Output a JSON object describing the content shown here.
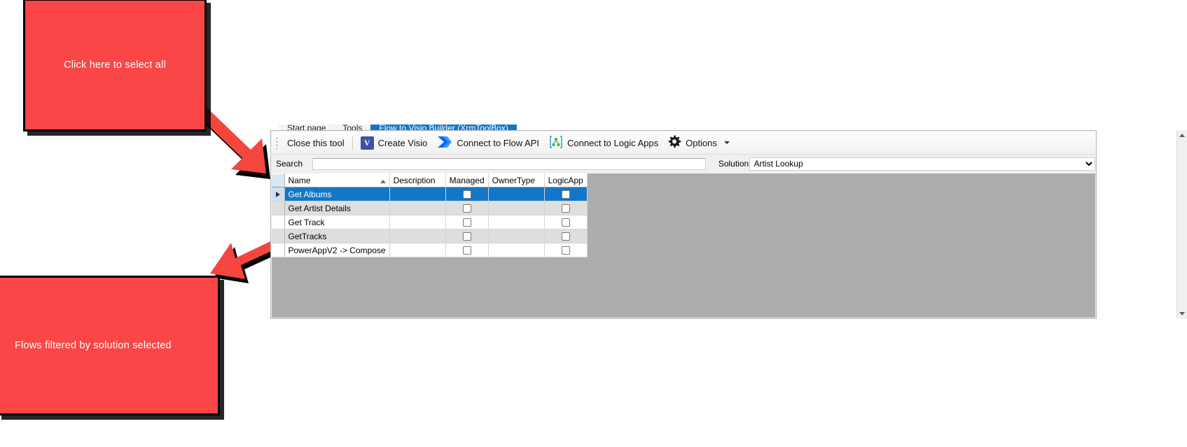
{
  "annotations": {
    "top_callout": "Click here to select all",
    "bottom_callout": "Flows filtered by solution selected",
    "color": "#fa4646"
  },
  "tabs": [
    {
      "label": "Start page",
      "active": false
    },
    {
      "label": "Tools",
      "active": false
    },
    {
      "label": "Flow to Visio Builder (XrmToolBox)",
      "active": true
    }
  ],
  "toolbar": {
    "close_tool": "Close this tool",
    "create_visio": "Create Visio",
    "connect_flow_api": "Connect to Flow API",
    "connect_logic_apps": "Connect to Logic Apps",
    "options": "Options",
    "icons": {
      "visio": "visio-icon",
      "flow": "power-automate-icon",
      "logic_apps": "logic-apps-icon",
      "options": "gear-icon",
      "dropdown": "chevron-down-icon"
    }
  },
  "search": {
    "label": "Search",
    "value": "",
    "placeholder": ""
  },
  "solution": {
    "label": "Solution",
    "selected": "Artist Lookup",
    "options": [
      "Artist Lookup"
    ]
  },
  "grid": {
    "columns": [
      "Name",
      "Description",
      "Managed",
      "OwnerType",
      "LogicApp"
    ],
    "sorted_column": "Name",
    "sort_direction": "ascending",
    "rows": [
      {
        "name": "Get Albums",
        "description": "",
        "managed": false,
        "ownertype": "",
        "logicapp": false,
        "selected": true
      },
      {
        "name": "Get Artist Details",
        "description": "",
        "managed": false,
        "ownertype": "",
        "logicapp": false,
        "selected": false
      },
      {
        "name": "Get Track",
        "description": "",
        "managed": false,
        "ownertype": "",
        "logicapp": false,
        "selected": false
      },
      {
        "name": "GetTracks",
        "description": "",
        "managed": false,
        "ownertype": "",
        "logicapp": false,
        "selected": false
      },
      {
        "name": "PowerAppV2 -> Compose",
        "description": "",
        "managed": false,
        "ownertype": "",
        "logicapp": false,
        "selected": false
      }
    ]
  }
}
